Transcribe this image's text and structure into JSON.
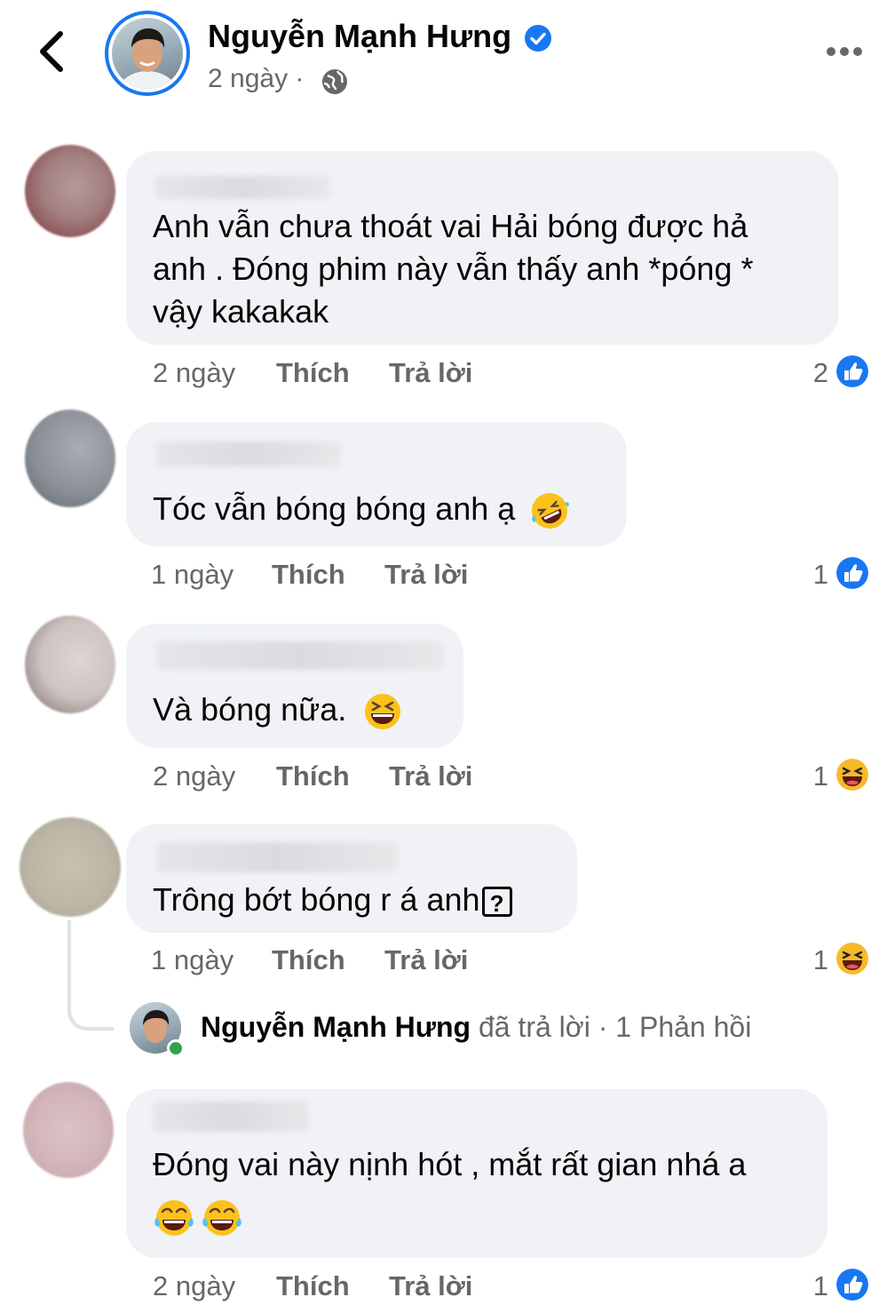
{
  "header": {
    "name": "Nguyễn Mạnh Hưng",
    "time": "2 ngày ·",
    "icons": {
      "back": "chevron-left-icon",
      "verified": "verified-badge-icon",
      "globe": "globe-icon",
      "more": "more-options-icon"
    }
  },
  "colors": {
    "accent": "#1877f2",
    "bubble": "#f0f2f5",
    "meta": "#65676b"
  },
  "actions": {
    "like": "Thích",
    "reply": "Trả lời"
  },
  "comments": [
    {
      "lines": [
        "Anh vẫn chưa thoát vai Hải bóng được  hả",
        "anh . Đóng phim này vẫn thấy anh *póng *",
        "vậy kakakak"
      ],
      "time": "2 ngày",
      "reaction_count": "2",
      "reaction": "like-reaction-icon"
    },
    {
      "lines": [
        "Tóc vẫn bóng bóng anh ạ"
      ],
      "emoji": "rolling-laughing-emoji",
      "time": "1 ngày",
      "reaction_count": "1",
      "reaction": "like-reaction-icon"
    },
    {
      "lines": [
        "Và bóng nữa."
      ],
      "emoji": "grinning-squint-emoji",
      "time": "2 ngày",
      "reaction_count": "1",
      "reaction": "haha-reaction-icon"
    },
    {
      "lines": [
        "Trông bớt bóng r á anh"
      ],
      "unknown_glyph": "?",
      "time": "1 ngày",
      "reaction_count": "1",
      "reaction": "haha-reaction-icon",
      "reply_summary": {
        "name": "Nguyễn Mạnh Hưng",
        "text": " đã trả lời · 1 Phản hồi"
      }
    },
    {
      "lines": [
        "Đóng vai này nịnh hót , mắt rất gian nhá a"
      ],
      "emoji": "tears-of-joy-emoji",
      "time": "2 ngày",
      "reaction_count": "1",
      "reaction": "like-reaction-icon"
    }
  ]
}
